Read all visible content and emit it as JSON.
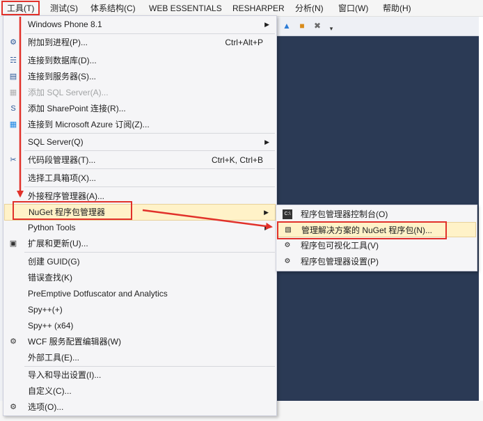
{
  "menubar": {
    "items": [
      "工具(T)",
      "测试(S)",
      "体系结构(C)",
      "WEB ESSENTIALS",
      "RESHARPER",
      "分析(N)",
      "窗口(W)",
      "帮助(H)"
    ]
  },
  "tools_menu": {
    "items": [
      {
        "label": "Windows Phone 8.1",
        "shortcut": "",
        "submenu": true
      },
      {
        "label": "附加到进程(P)...",
        "shortcut": "Ctrl+Alt+P",
        "icon": "attach-process-icon"
      },
      {
        "label": "连接到数据库(D)...",
        "shortcut": "",
        "icon": "database-connect-icon"
      },
      {
        "label": "连接到服务器(S)...",
        "shortcut": "",
        "icon": "server-connect-icon"
      },
      {
        "label": "添加 SQL Server(A)...",
        "shortcut": "",
        "icon": "sql-server-icon",
        "disabled": true
      },
      {
        "label": "添加 SharePoint 连接(R)...",
        "shortcut": "",
        "icon": "sharepoint-icon"
      },
      {
        "label": "连接到 Microsoft Azure 订阅(Z)...",
        "shortcut": "",
        "icon": "windows-icon"
      },
      {
        "label": "SQL Server(Q)",
        "shortcut": "",
        "submenu": true
      },
      {
        "label": "代码段管理器(T)...",
        "shortcut": "Ctrl+K, Ctrl+B",
        "icon": "snippet-icon"
      },
      {
        "label": "选择工具箱项(X)...",
        "shortcut": ""
      },
      {
        "label": "外接程序管理器(A)...",
        "shortcut": ""
      },
      {
        "label": "NuGet 程序包管理器",
        "shortcut": "",
        "submenu": true,
        "highlighted": true
      },
      {
        "label": "Python Tools",
        "shortcut": "",
        "submenu": true
      },
      {
        "label": "扩展和更新(U)...",
        "shortcut": "",
        "icon": "extensions-icon"
      },
      {
        "label": "创建 GUID(G)",
        "shortcut": ""
      },
      {
        "label": "错误查找(K)",
        "shortcut": ""
      },
      {
        "label": "PreEmptive Dotfuscator and Analytics",
        "shortcut": ""
      },
      {
        "label": "Spy++(+)",
        "shortcut": ""
      },
      {
        "label": "Spy++ (x64)",
        "shortcut": ""
      },
      {
        "label": "WCF 服务配置编辑器(W)",
        "shortcut": "",
        "icon": "wcf-gear-icon"
      },
      {
        "label": "外部工具(E)...",
        "shortcut": ""
      },
      {
        "label": "导入和导出设置(I)...",
        "shortcut": ""
      },
      {
        "label": "自定义(C)...",
        "shortcut": ""
      },
      {
        "label": "选项(O)...",
        "shortcut": "",
        "icon": "gear-icon"
      }
    ]
  },
  "nuget_submenu": {
    "items": [
      {
        "label": "程序包管理器控制台(O)",
        "icon": "console-icon"
      },
      {
        "label": "管理解决方案的 NuGet 程序包(N)...",
        "icon": "package-icon",
        "highlighted": true
      },
      {
        "label": "程序包可视化工具(V)",
        "icon": "hierarchy-icon"
      },
      {
        "label": "程序包管理器设置(P)",
        "icon": "gear-icon"
      }
    ]
  },
  "colors": {
    "annotation": "#e1312a",
    "highlight": "#fff2c8",
    "editor_bg": "#2b3a55"
  }
}
